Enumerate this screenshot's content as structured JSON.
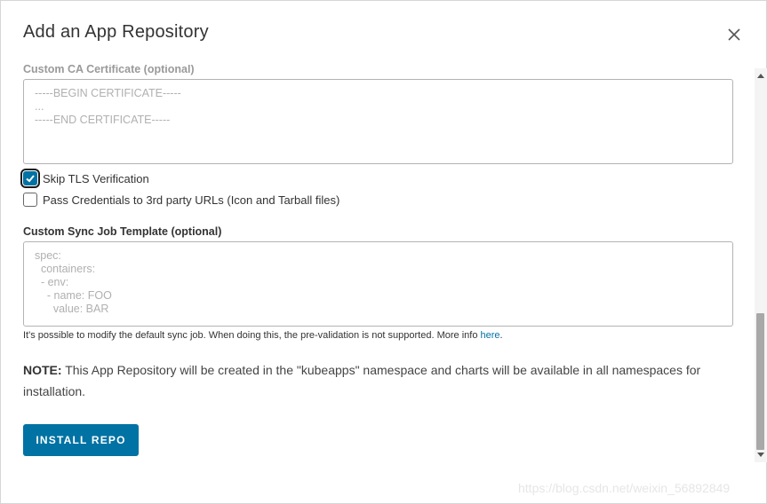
{
  "modal": {
    "title": "Add an App Repository"
  },
  "ca_certificate": {
    "label": "Custom CA Certificate (optional)",
    "placeholder": "-----BEGIN CERTIFICATE-----\n...\n-----END CERTIFICATE-----"
  },
  "checkboxes": [
    {
      "label": "Skip TLS Verification",
      "checked": true
    },
    {
      "label": "Pass Credentials to 3rd party URLs (Icon and Tarball files)",
      "checked": false
    }
  ],
  "sync_job": {
    "label": "Custom Sync Job Template (optional)",
    "placeholder": "spec:\n  containers:\n  - env:\n    - name: FOO\n      value: BAR",
    "helper_text": "It's possible to modify the default sync job. When doing this, the pre-validation is not supported. More info ",
    "helper_link": "here",
    "helper_suffix": "."
  },
  "note": {
    "prefix": "NOTE:",
    "text": " This App Repository will be created in the \"kubeapps\" namespace and charts will be available in all namespaces for installation."
  },
  "install_button": "INSTALL REPO",
  "watermark": "https://blog.csdn.net/weixin_56892849",
  "colors": {
    "primary": "#0072a3",
    "placeholder": "#b0b0b0"
  },
  "icons": {
    "close": "close-icon",
    "check": "check-icon"
  }
}
